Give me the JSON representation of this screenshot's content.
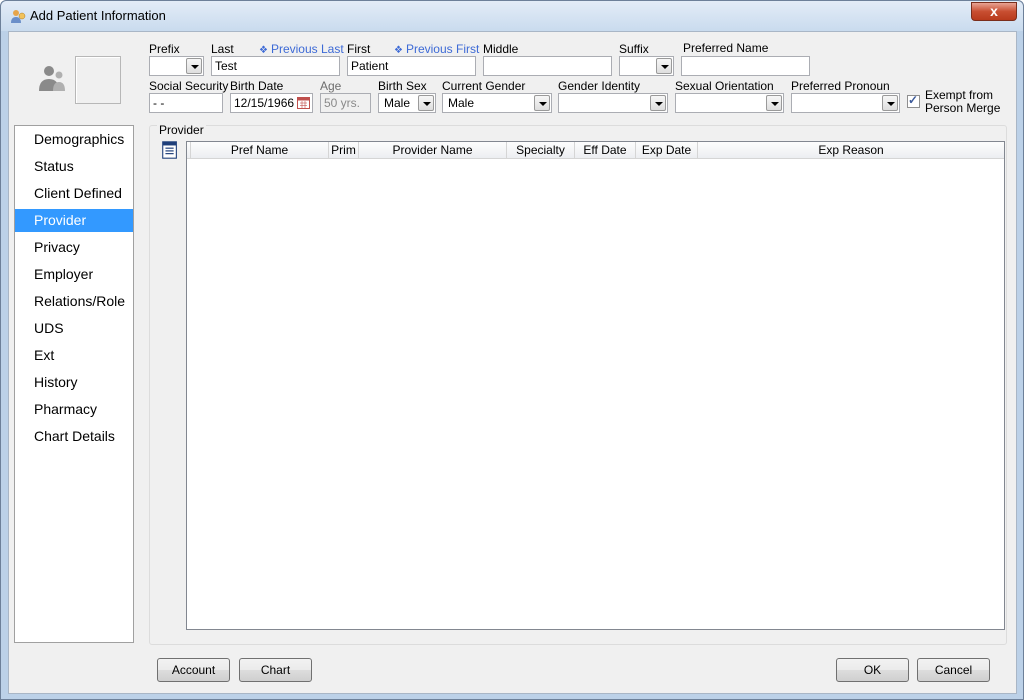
{
  "window": {
    "title": "Add Patient Information",
    "close_glyph": "x"
  },
  "header": {
    "prefix": {
      "label": "Prefix",
      "value": ""
    },
    "last": {
      "label": "Last",
      "value": "Test",
      "previous_link": "Previous Last"
    },
    "first": {
      "label": "First",
      "value": "Patient",
      "previous_link": "Previous First"
    },
    "middle": {
      "label": "Middle",
      "value": ""
    },
    "suffix": {
      "label": "Suffix",
      "value": ""
    },
    "preferred_name": {
      "label": "Preferred Name",
      "value": ""
    },
    "ssn": {
      "label": "Social Security",
      "value": " -  -"
    },
    "birth_date": {
      "label": "Birth Date",
      "value": "12/15/1966"
    },
    "age": {
      "label": "Age",
      "value": "50 yrs."
    },
    "birth_sex": {
      "label": "Birth Sex",
      "value": "Male"
    },
    "current_gender": {
      "label": "Current Gender",
      "value": "Male"
    },
    "gender_identity": {
      "label": "Gender Identity",
      "value": ""
    },
    "sexual_orientation": {
      "label": "Sexual Orientation",
      "value": ""
    },
    "preferred_pronoun": {
      "label": "Preferred Pronoun",
      "value": ""
    },
    "exempt": {
      "label_line1": "Exempt from",
      "label_line2": "Person Merge",
      "checked": true,
      "mark": "✓"
    }
  },
  "nav": {
    "items": [
      {
        "label": "Demographics",
        "active": false
      },
      {
        "label": "Status",
        "active": false
      },
      {
        "label": "Client Defined",
        "active": false
      },
      {
        "label": "Provider",
        "active": true
      },
      {
        "label": "Privacy",
        "active": false
      },
      {
        "label": "Employer",
        "active": false
      },
      {
        "label": "Relations/Role",
        "active": false
      },
      {
        "label": "UDS",
        "active": false
      },
      {
        "label": "Ext",
        "active": false
      },
      {
        "label": "History",
        "active": false
      },
      {
        "label": "Pharmacy",
        "active": false
      },
      {
        "label": "Chart Details",
        "active": false
      }
    ]
  },
  "provider": {
    "group_title": "Provider",
    "columns": [
      "Pref Name",
      "Prim",
      "Provider Name",
      "Specialty",
      "Eff Date",
      "Exp Date",
      "Exp Reason"
    ],
    "rows": []
  },
  "footer": {
    "account_label": "Account",
    "chart_label": "Chart",
    "ok_label": "OK",
    "cancel_label": "Cancel"
  },
  "colors": {
    "selection": "#3399ff",
    "link": "#3d6ad6",
    "titlebar": "#c9dbee",
    "close": "#c84e31"
  },
  "icons": [
    "person-icon",
    "calendar-icon",
    "list-icon",
    "close-icon"
  ]
}
